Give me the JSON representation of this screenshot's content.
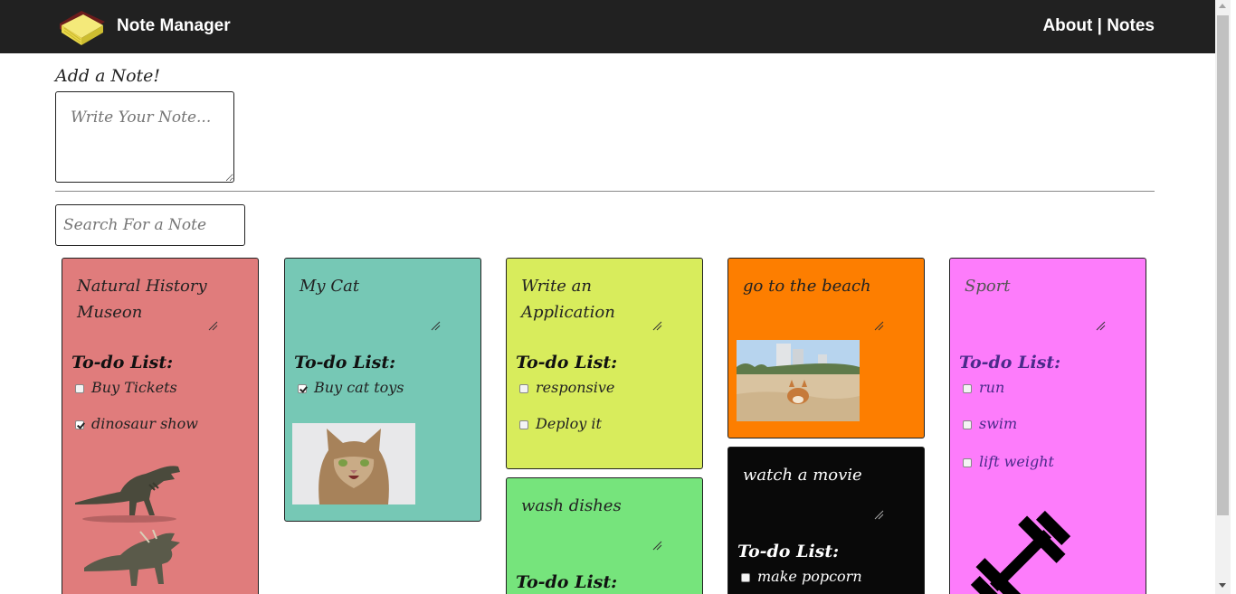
{
  "navbar": {
    "brand": "Note Manager",
    "about_label": "About",
    "separator": " | ",
    "notes_label": "Notes"
  },
  "add_note": {
    "label": "Add a Note!",
    "placeholder": "Write Your Note..."
  },
  "search": {
    "placeholder": "Search For a Note"
  },
  "notes": [
    {
      "title": "Natural History Museon",
      "color": "#e07c7c",
      "todo_label": "To-do List:",
      "items": [
        {
          "text": "Buy Tickets",
          "checked": false
        },
        {
          "text": "dinosaur show",
          "checked": true
        }
      ],
      "images": [
        "t-rex-icon",
        "triceratops-icon"
      ]
    },
    {
      "title": "My Cat",
      "color": "#76c8b5",
      "todo_label": "To-do List:",
      "items": [
        {
          "text": "Buy cat toys",
          "checked": true
        }
      ],
      "images": [
        "cat-photo"
      ]
    },
    {
      "title": "Write an Application",
      "color": "#d8ec5c",
      "todo_label": "To-do List:",
      "items": [
        {
          "text": "responsive",
          "checked": false
        },
        {
          "text": "Deploy it",
          "checked": false
        }
      ]
    },
    {
      "title": "wash dishes",
      "color": "#76e47c",
      "todo_label": "To-do List:",
      "items": []
    },
    {
      "title": "go to the beach",
      "color": "#fd7e00",
      "images": [
        "beach-dog-photo"
      ]
    },
    {
      "title": "watch a movie",
      "color": "#090909",
      "todo_label": "To-do List:",
      "items": [
        {
          "text": "make popcorn",
          "checked": false
        }
      ]
    },
    {
      "title": "Sport",
      "color": "#fd7cfb",
      "todo_label": "To-do List:",
      "items": [
        {
          "text": "run",
          "checked": false
        },
        {
          "text": "swim",
          "checked": false
        },
        {
          "text": "lift weight",
          "checked": false
        }
      ],
      "images": [
        "dumbbell-icon"
      ]
    }
  ]
}
